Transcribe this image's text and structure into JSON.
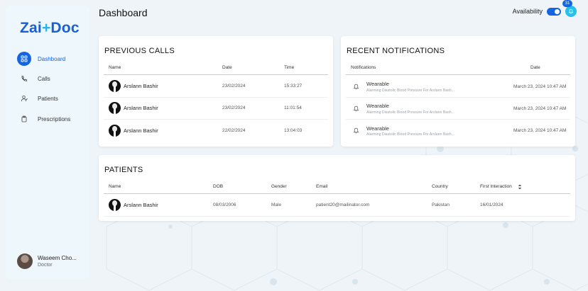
{
  "brand": {
    "logo": "ZaiDoc"
  },
  "sidebar": {
    "items": [
      {
        "label": "Dashboard",
        "icon": "grid-icon",
        "active": true
      },
      {
        "label": "Calls",
        "icon": "phone-icon",
        "active": false
      },
      {
        "label": "Patients",
        "icon": "user-icon",
        "active": false
      },
      {
        "label": "Prescriptions",
        "icon": "clipboard-icon",
        "active": false
      }
    ],
    "user": {
      "name": "Waseem Cho...",
      "role": "Doctor"
    }
  },
  "header": {
    "title": "Dashboard",
    "availability_label": "Availability",
    "availability_on": true,
    "notification_count": "31"
  },
  "previous_calls": {
    "title": "PREVIOUS CALLS",
    "columns": [
      "Name",
      "Date",
      "Time"
    ],
    "rows": [
      {
        "name": "Arslann Bashir",
        "date": "23/02/2024",
        "time": "15:33:27"
      },
      {
        "name": "Arslann Bashir",
        "date": "23/02/2024",
        "time": "11:01:54"
      },
      {
        "name": "Arslann Bashir",
        "date": "22/02/2024",
        "time": "13:04:03"
      }
    ]
  },
  "recent_notifications": {
    "title": "RECENT NOTIFICATIONS",
    "columns": [
      "Notifications",
      "Date"
    ],
    "rows": [
      {
        "title": "Wearable",
        "subtitle": "Alarming Diastolic Blood Pressure For Arslann Bash...",
        "date": "March 23, 2024 10:47 AM"
      },
      {
        "title": "Wearable",
        "subtitle": "Alarming Diastolic Blood Pressure For Arslann Bash...",
        "date": "March 23, 2024 10:47 AM"
      },
      {
        "title": "Wearable",
        "subtitle": "Alarming Diastolic Blood Pressure For Arslann Bash...",
        "date": "March 23, 2024 10:47 AM"
      }
    ]
  },
  "patients": {
    "title": "PATIENTS",
    "columns": [
      "Name",
      "DOB",
      "Gender",
      "Email",
      "Country",
      "First Interaction"
    ],
    "sort_icon": "sort-icon",
    "rows": [
      {
        "name": "Arslann Bashir",
        "dob": "08/03/2006",
        "gender": "Male",
        "email": "patient20@mailinator.com",
        "country": "Pakistan",
        "first_interaction": "16/01/2024"
      }
    ]
  },
  "colors": {
    "primary": "#1565e0",
    "accent": "#27c0ea",
    "background": "#eef4f8"
  }
}
